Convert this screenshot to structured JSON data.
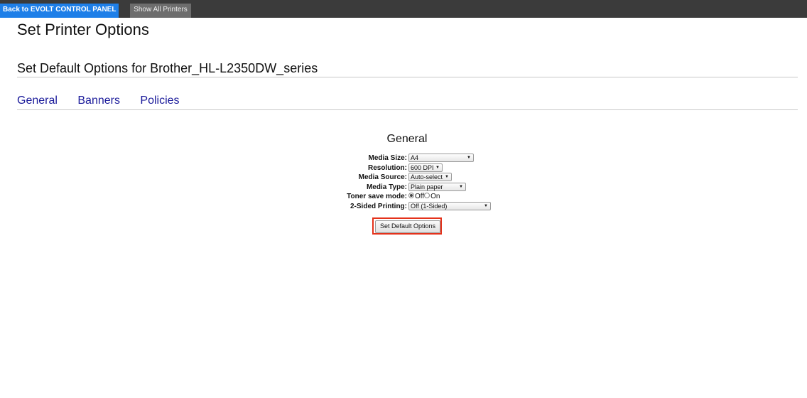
{
  "topbar": {
    "back_label": "Back to EVOLT CONTROL PANEL",
    "printers_label": "Show All Printers"
  },
  "page": {
    "title": "Set Printer Options",
    "subtitle": "Set Default Options for Brother_HL-L2350DW_series"
  },
  "tabs": [
    {
      "label": "General"
    },
    {
      "label": "Banners"
    },
    {
      "label": "Policies"
    }
  ],
  "section": {
    "title": "General"
  },
  "form": {
    "media_size": {
      "label": "Media Size:",
      "value": "A4"
    },
    "resolution": {
      "label": "Resolution:",
      "value": "600 DPI"
    },
    "media_source": {
      "label": "Media Source:",
      "value": "Auto-select"
    },
    "media_type": {
      "label": "Media Type:",
      "value": "Plain paper"
    },
    "toner_save": {
      "label": "Toner save mode:",
      "options": [
        "Off",
        "On"
      ],
      "selected": "Off"
    },
    "duplex": {
      "label": "2-Sided Printing:",
      "value": "Off (1-Sided)"
    },
    "submit_label": "Set Default Options"
  }
}
